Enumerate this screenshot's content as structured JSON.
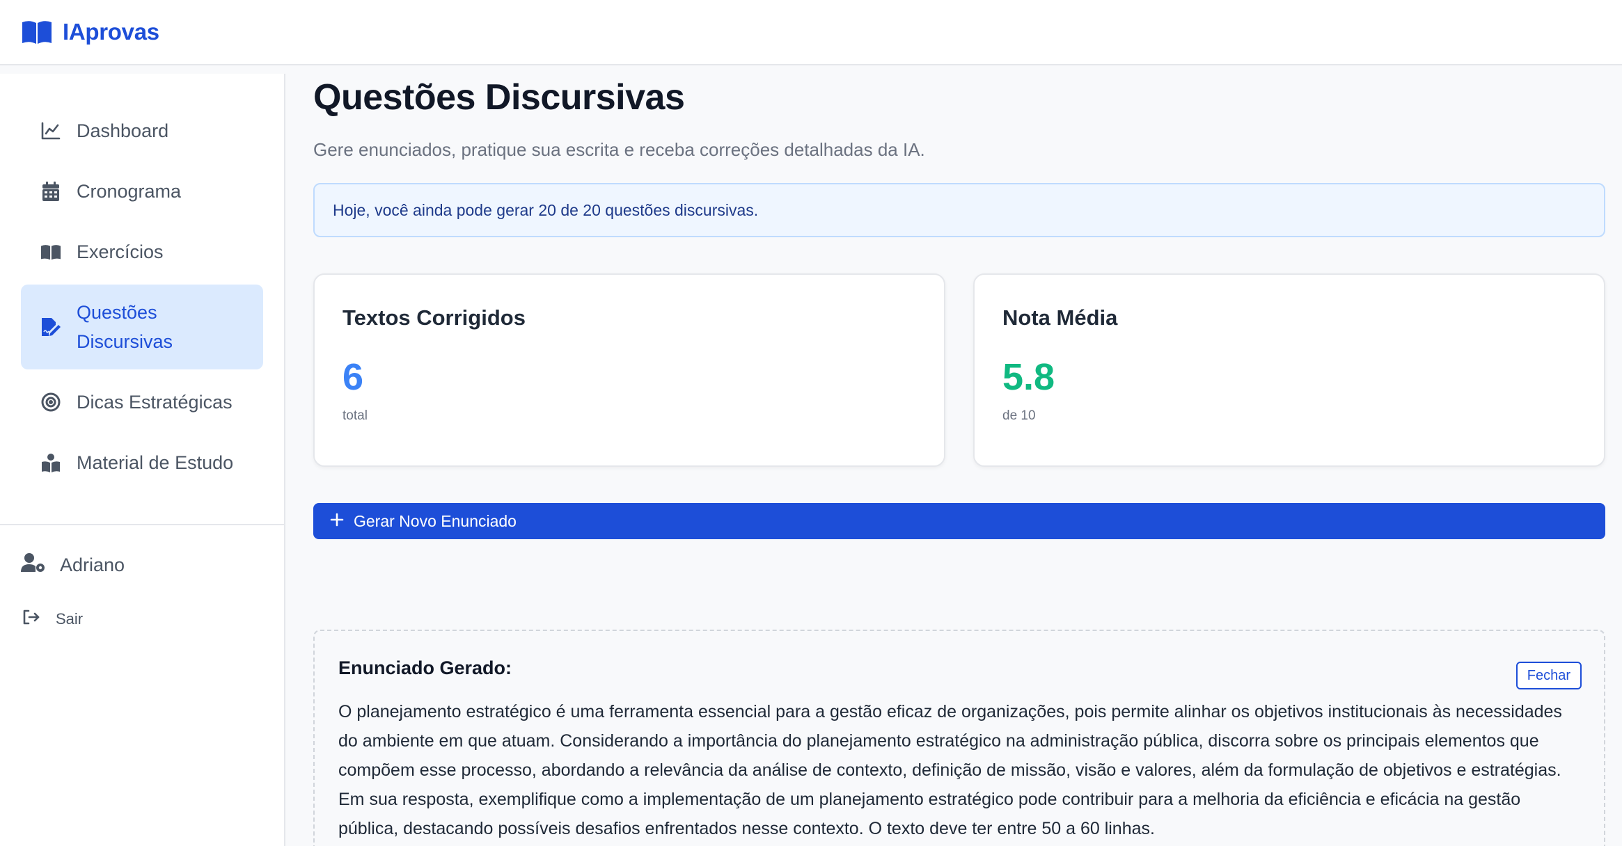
{
  "brand": {
    "name": "IAprovas"
  },
  "sidebar": {
    "items": [
      {
        "label": "Dashboard",
        "icon": "chart-line-icon"
      },
      {
        "label": "Cronograma",
        "icon": "calendar-icon"
      },
      {
        "label": "Exercícios",
        "icon": "book-open-icon"
      },
      {
        "label": "Questões Discursivas",
        "icon": "file-signature-icon",
        "active": true
      },
      {
        "label": "Dicas Estratégicas",
        "icon": "target-icon"
      },
      {
        "label": "Material de Estudo",
        "icon": "book-reader-icon"
      }
    ],
    "user": {
      "name": "Adriano",
      "icon": "user-gear-icon"
    },
    "logout": {
      "label": "Sair",
      "icon": "sign-out-icon"
    }
  },
  "main": {
    "title": "Questões Discursivas",
    "subtitle": "Gere enunciados, pratique sua escrita e receba correções detalhadas da IA.",
    "quota_notice": "Hoje, você ainda pode gerar 20 de 20 questões discursivas.",
    "stats": [
      {
        "title": "Textos Corrigidos",
        "value": "6",
        "caption": "total",
        "color": "#3b82f6"
      },
      {
        "title": "Nota Média",
        "value": "5.8",
        "caption": "de 10",
        "color": "#10b981"
      }
    ],
    "generate_button": {
      "label": "Gerar Novo Enunciado",
      "icon": "plus-icon"
    },
    "statement": {
      "title": "Enunciado Gerado:",
      "close_label": "Fechar",
      "text": "O planejamento estratégico é uma ferramenta essencial para a gestão eficaz de organizações, pois permite alinhar os objetivos institucionais às necessidades do ambiente em que atuam. Considerando a importância do planejamento estratégico na administração pública, discorra sobre os principais elementos que compõem esse processo, abordando a relevância da análise de contexto, definição de missão, visão e valores, além da formulação de objetivos e estratégias. Em sua resposta, exemplifique como a implementação de um planejamento estratégico pode contribuir para a melhoria da eficiência e eficácia na gestão pública, destacando possíveis desafios enfrentados nesse contexto. O texto deve ter entre 50 a 60 linhas."
    }
  },
  "colors": {
    "accent": "#1d4ed8",
    "active_bg": "#dbeafe",
    "stat_blue": "#3b82f6",
    "stat_green": "#10b981"
  }
}
